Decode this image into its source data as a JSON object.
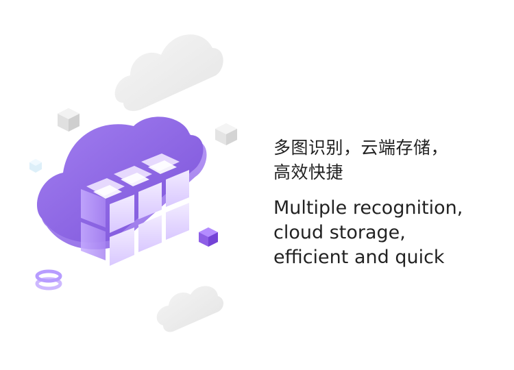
{
  "headline_zh": {
    "line1": "多图识别，云端存储，",
    "line2": "高效快捷"
  },
  "headline_en": {
    "line1": "Multiple recognition,",
    "line2": "cloud storage,",
    "line3": "efficient and quick"
  },
  "colors": {
    "accent_purple": "#8a5ce0",
    "cloud_grey": "#e8e8e8",
    "text": "#222222"
  },
  "icons": [
    "cloud-storage-illustration",
    "cube-icon",
    "ring-icon"
  ]
}
